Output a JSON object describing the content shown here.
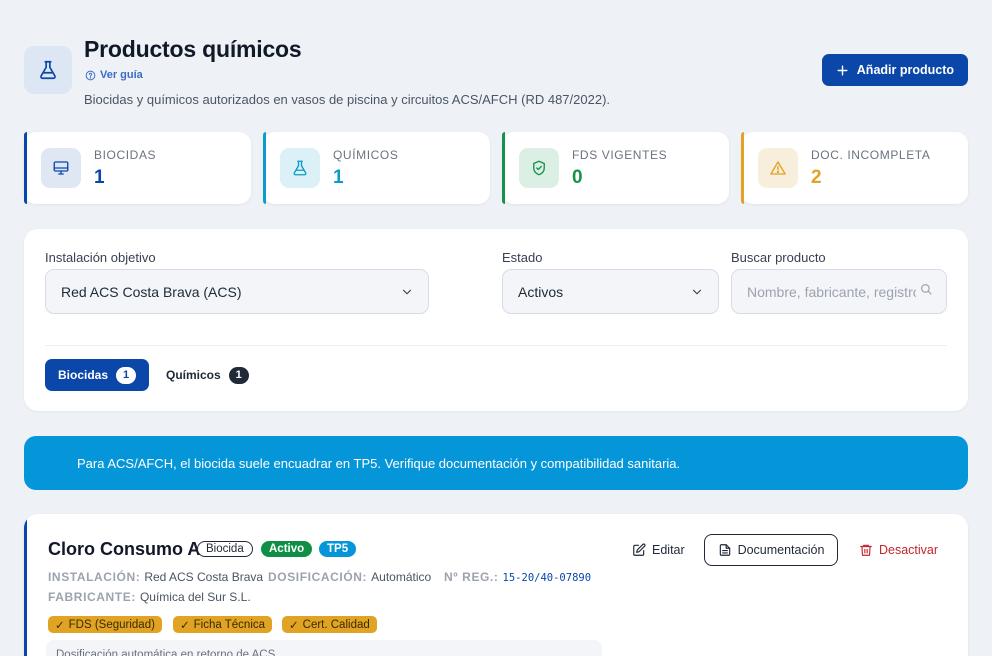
{
  "header": {
    "title": "Productos químicos",
    "guide_label": "Ver guía",
    "subtitle": "Biocidas y químicos autorizados en vasos de piscina y circuitos ACS/AFCH (RD 487/2022).",
    "add_button": "Añadir producto",
    "icon": "flask-icon"
  },
  "stats": [
    {
      "label": "BIOCIDAS",
      "value": "1",
      "icon": "monitor-icon",
      "color": "#0a47a9"
    },
    {
      "label": "QUÍMICOS",
      "value": "1",
      "icon": "flask-icon",
      "color": "#0d9bc9"
    },
    {
      "label": "FDS VIGENTES",
      "value": "0",
      "icon": "shield-check-icon",
      "color": "#16924f"
    },
    {
      "label": "DOC. INCOMPLETA",
      "value": "2",
      "icon": "warning-icon",
      "color": "#e0a323"
    }
  ],
  "filters": {
    "installation_label": "Instalación objetivo",
    "installation_value": "Red ACS Costa Brava (ACS)",
    "status_label": "Estado",
    "status_value": "Activos",
    "search_label": "Buscar producto",
    "search_placeholder": "Nombre, fabricante, registro..."
  },
  "tabs": [
    {
      "label": "Biocidas",
      "count": "1",
      "active": true
    },
    {
      "label": "Químicos",
      "count": "1",
      "active": false
    }
  ],
  "banner": {
    "text": "Para ACS/AFCH, el biocida suele encuadrar en TP5. Verifique documentación y compatibilidad sanitaria."
  },
  "product": {
    "name": "Cloro Consumo A",
    "badges": {
      "type": "Biocida",
      "status": "Activo",
      "tp": "TP5"
    },
    "installation_key": "INSTALACIÓN:",
    "installation_value": "Red ACS Costa Brava",
    "dosing_key": "DOSIFICACIÓN:",
    "dosing_value": "Automático",
    "reg_key": "Nº REG.:",
    "reg_value": "15-20/40-07890",
    "maker_key": "FABRICANTE:",
    "maker_value": "Química del Sur S.L.",
    "docs": [
      "FDS (Seguridad)",
      "Ficha Técnica",
      "Cert. Calidad"
    ],
    "note": "Dosificación automática en retorno de ACS",
    "actions": {
      "edit": "Editar",
      "documents": "Documentación",
      "deactivate": "Desactivar"
    }
  },
  "colors": {
    "primary": "#0a47a9",
    "info": "#0596da",
    "success": "#16924f",
    "warning": "#e0a323",
    "danger": "#c2252b"
  }
}
